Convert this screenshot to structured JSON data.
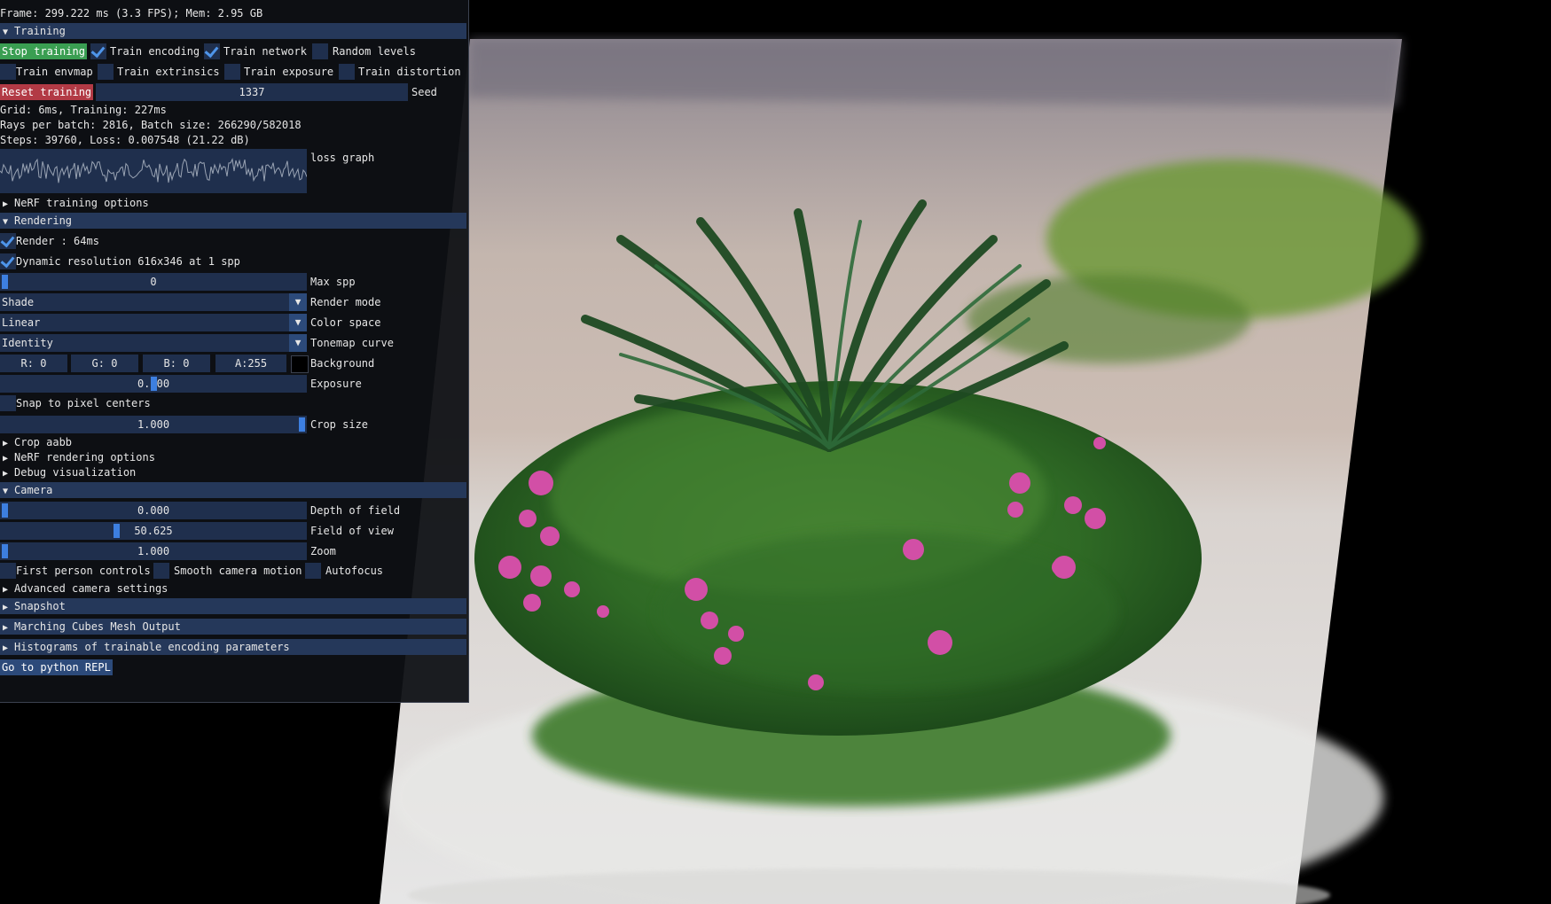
{
  "status": {
    "frame_line": "Frame: 299.222 ms (3.3 FPS); Mem: 2.95 GB"
  },
  "training": {
    "header": "Training",
    "stop_button": "Stop training",
    "train_encoding": {
      "label": "Train encoding",
      "checked": true
    },
    "train_network": {
      "label": "Train network",
      "checked": true
    },
    "random_levels": {
      "label": "Random levels",
      "checked": false
    },
    "train_envmap": {
      "label": "Train envmap",
      "checked": false
    },
    "train_extrinsics": {
      "label": "Train extrinsics",
      "checked": false
    },
    "train_exposure": {
      "label": "Train exposure",
      "checked": false
    },
    "train_distortion": {
      "label": "Train distortion",
      "checked": false
    },
    "reset_button": "Reset training",
    "seed_value": "1337",
    "seed_label": "Seed",
    "timing_line": "Grid: 6ms, Training: 227ms",
    "batch_line": "Rays per batch: 2816, Batch size: 266290/582018",
    "steps_line": "Steps: 39760, Loss: 0.007548 (21.22 dB)",
    "loss_graph_label": "loss graph",
    "nerf_training_options": "NeRF training options"
  },
  "rendering": {
    "header": "Rendering",
    "render": {
      "label": "Render : 64ms",
      "checked": true
    },
    "dynamic_resolution": {
      "label": "Dynamic resolution 616x346 at 1 spp",
      "checked": true
    },
    "max_spp": {
      "value": "0",
      "label": "Max spp",
      "fraction": 0.0
    },
    "render_mode": {
      "value": "Shade",
      "label": "Render mode"
    },
    "color_space": {
      "value": "Linear",
      "label": "Color space"
    },
    "tonemap_curve": {
      "value": "Identity",
      "label": "Tonemap curve"
    },
    "background": {
      "r": "R:  0",
      "g": "G:  0",
      "b": "B:  0",
      "a": "A:255",
      "label": "Background",
      "swatch_color": "#000000"
    },
    "exposure": {
      "value": "0.000",
      "label": "Exposure",
      "fraction": 0.5
    },
    "snap_pixel_centers": {
      "label": "Snap to pixel centers",
      "checked": false
    },
    "crop_size": {
      "value": "1.000",
      "label": "Crop size",
      "fraction": 1.0
    },
    "crop_aabb": "Crop aabb",
    "nerf_rendering_options": "NeRF rendering options",
    "debug_visualization": "Debug visualization"
  },
  "camera": {
    "header": "Camera",
    "depth_of_field": {
      "value": "0.000",
      "label": "Depth of field",
      "fraction": 0.0
    },
    "field_of_view": {
      "value": "50.625",
      "label": "Field of view",
      "fraction": 0.375
    },
    "zoom": {
      "value": "1.000",
      "label": "Zoom",
      "fraction": 0.0
    },
    "first_person": {
      "label": "First person controls",
      "checked": false
    },
    "smooth_motion": {
      "label": "Smooth camera motion",
      "checked": false
    },
    "autofocus": {
      "label": "Autofocus",
      "checked": false
    },
    "advanced_settings": "Advanced camera settings"
  },
  "snapshot": {
    "header": "Snapshot"
  },
  "marching_cubes": {
    "header": "Marching Cubes Mesh Output"
  },
  "histograms": {
    "header": "Histograms of trainable encoding parameters"
  },
  "python_repl_button": "Go to python REPL",
  "colors": {
    "header_bg": "#25385a",
    "frame_bg": "#1f2f4d",
    "check_mark": "#4e95ea",
    "stop_button": "#3a9e52",
    "reset_button": "#b23a45"
  }
}
